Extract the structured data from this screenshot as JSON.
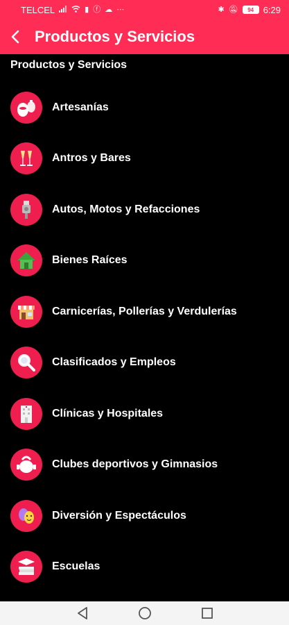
{
  "status_bar": {
    "carrier": "TELCEL",
    "battery": "94",
    "time": "6:29"
  },
  "app_bar": {
    "title": "Productos y Servicios"
  },
  "section": {
    "heading": "Productos y Servicios"
  },
  "categories": [
    {
      "label": "Artesanías",
      "icon": "pottery-icon"
    },
    {
      "label": "Antros y Bares",
      "icon": "champagne-glasses-icon"
    },
    {
      "label": "Autos, Motos y Refacciones",
      "icon": "car-part-icon"
    },
    {
      "label": "Bienes Raíces",
      "icon": "house-icon"
    },
    {
      "label": "Carnicerías, Pollerías y Verdulerías",
      "icon": "shop-icon"
    },
    {
      "label": "Clasificados y Empleos",
      "icon": "magnifier-icon"
    },
    {
      "label": "Clínicas y Hospitales",
      "icon": "hospital-building-icon"
    },
    {
      "label": "Clubes deportivos y Gimnasios",
      "icon": "kettlebell-icon"
    },
    {
      "label": "Diversión y Espectáculos",
      "icon": "theater-masks-icon"
    },
    {
      "label": "Escuelas",
      "icon": "books-graduation-cap-icon"
    }
  ],
  "colors": {
    "accent": "#ff2d55",
    "icon_bg": "#ee1f4f",
    "background": "#000000",
    "nav_bar": "#f4f4f4"
  }
}
